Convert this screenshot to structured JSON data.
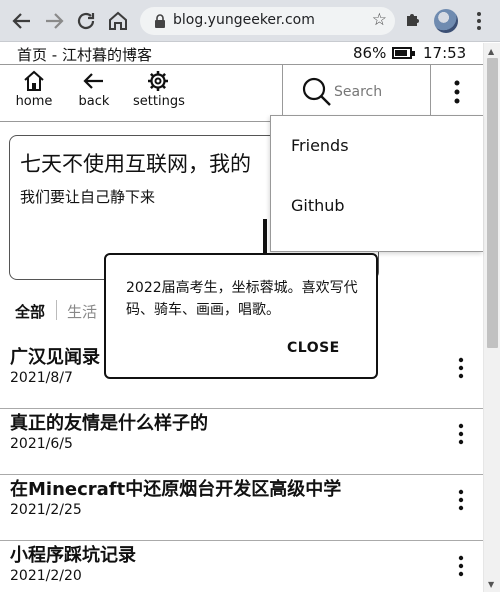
{
  "browser": {
    "url": "blog.yungeeker.com",
    "back_icon": "arrow-left-icon",
    "forward_icon": "arrow-right-icon",
    "reload_icon": "reload-icon",
    "home_icon": "home-icon"
  },
  "statusbar": {
    "title": "首页 - 江村暮的博客",
    "battery": "86%",
    "battery_level": 0.86,
    "time": "17:53"
  },
  "toolbar": {
    "home_label": "home",
    "back_label": "back",
    "settings_label": "settings",
    "search_placeholder": "Search"
  },
  "hero": {
    "title": "七天不使用互联网，我的",
    "subtitle": "我们要让自己静下来"
  },
  "tabs": [
    {
      "label": "全部"
    },
    {
      "label": "生活"
    }
  ],
  "posts": [
    {
      "title": "广汉见闻录",
      "date": "2021/8/7"
    },
    {
      "title": "真正的友情是什么样子的",
      "date": "2021/6/5"
    },
    {
      "title": "在Minecraft中还原烟台开发区高级中学",
      "date": "2021/2/25"
    },
    {
      "title": "小程序踩坑记录",
      "date": "2021/2/20"
    }
  ],
  "dropdown": {
    "items": [
      {
        "label": "Friends"
      },
      {
        "label": "Github"
      }
    ]
  },
  "dialog": {
    "text": "2022届高考生，坐标蓉城。喜欢写代码、骑车、画画，唱歌。",
    "close_label": "CLOSE"
  }
}
